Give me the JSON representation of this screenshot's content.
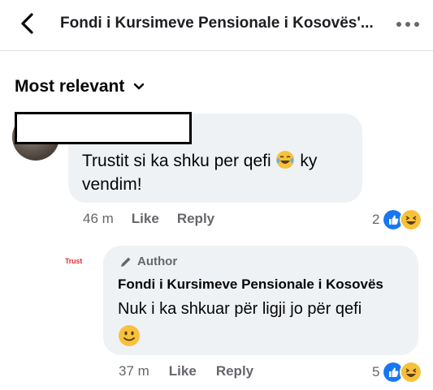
{
  "header": {
    "title": "Fondi i Kursimeve Pensionale i Kosovës'...",
    "back_icon": "chevron-left-icon",
    "more_icon": "ellipsis-icon"
  },
  "sort": {
    "label": "Most relevant",
    "icon": "chevron-down-icon"
  },
  "comments": [
    {
      "text": "Trustit si ka shku per qefi",
      "text_after_emoji": "ky vendim!",
      "emoji": "laughing-tears-emoji",
      "time": "46 m",
      "like_label": "Like",
      "reply_label": "Reply",
      "reaction_count": "2"
    },
    {
      "avatar_label": "Trust",
      "author_badge": "Author",
      "name": "Fondi i Kursimeve Pensionale i Kosovës",
      "text": "Nuk i ka shkuar për ligji jo për qefi",
      "emoji": "smile-emoji",
      "time": "37 m",
      "like_label": "Like",
      "reply_label": "Reply",
      "reaction_count": "5"
    }
  ],
  "colors": {
    "like_blue": "#1877f2",
    "haha_yellow": "#f7c13b",
    "meta_gray": "#65676b",
    "bubble_bg": "#eff2f5"
  }
}
